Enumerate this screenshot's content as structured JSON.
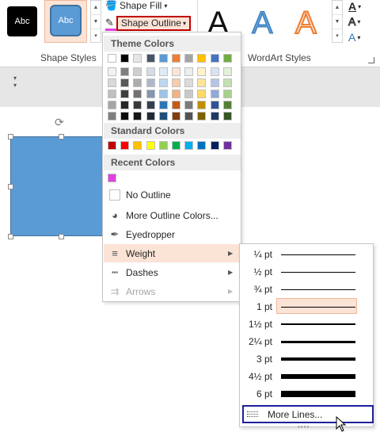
{
  "ribbon": {
    "style_sample_1": "Abc",
    "style_sample_2": "Abc",
    "shape_fill_label": "Shape Fill",
    "shape_outline_label": "Shape Outline",
    "shape_styles_label": "Shape Styles",
    "wordart_styles_label": "WordArt Styles",
    "wordart_sample": "A",
    "text_fill_letter": "A",
    "text_outline_letter": "A",
    "text_effects_letter": "A"
  },
  "menu": {
    "theme_colors_title": "Theme Colors",
    "standard_colors_title": "Standard Colors",
    "recent_colors_title": "Recent Colors",
    "theme_top_row": [
      "#ffffff",
      "#000000",
      "#e7e6e6",
      "#44546a",
      "#5b9bd5",
      "#ed7d31",
      "#a5a5a5",
      "#ffc000",
      "#4472c4",
      "#70ad47"
    ],
    "theme_shades": [
      [
        "#f2f2f2",
        "#7f7f7f",
        "#d0cece",
        "#d6dce4",
        "#deebf6",
        "#fbe4d5",
        "#ededed",
        "#fff2cc",
        "#dae3f3",
        "#e2efd9"
      ],
      [
        "#d8d8d8",
        "#595959",
        "#aeabab",
        "#adb9ca",
        "#bdd7ee",
        "#f7cbac",
        "#dbdbdb",
        "#ffe599",
        "#b4c6e7",
        "#c5e0b3"
      ],
      [
        "#bfbfbf",
        "#3f3f3f",
        "#757070",
        "#8496b0",
        "#9dc3e6",
        "#f4b183",
        "#c9c9c9",
        "#ffd965",
        "#8eaadb",
        "#a8d08d"
      ],
      [
        "#a5a5a5",
        "#262626",
        "#3a3838",
        "#323f4f",
        "#2e75b5",
        "#c55a11",
        "#7b7b7b",
        "#bf8f00",
        "#2f5496",
        "#538135"
      ],
      [
        "#7f7f7f",
        "#0c0c0c",
        "#171616",
        "#222a35",
        "#1e4e79",
        "#833c0b",
        "#525252",
        "#7f6000",
        "#1f3864",
        "#375623"
      ]
    ],
    "standard_colors": [
      "#c00000",
      "#ff0000",
      "#ffc000",
      "#ffff00",
      "#92d050",
      "#00b050",
      "#00b0f0",
      "#0070c0",
      "#002060",
      "#7030a0"
    ],
    "recent_colors": [
      "#e040e0"
    ],
    "no_outline": "No Outline",
    "more_outline_colors": "More Outline Colors...",
    "eyedropper": "Eyedropper",
    "weight": "Weight",
    "dashes": "Dashes",
    "arrows": "Arrows"
  },
  "weights": [
    {
      "label": "¼ pt",
      "value": 0.25,
      "selected": false
    },
    {
      "label": "½ pt",
      "value": 0.5,
      "selected": false
    },
    {
      "label": "¾ pt",
      "value": 0.75,
      "selected": false
    },
    {
      "label": "1 pt",
      "value": 1,
      "selected": true
    },
    {
      "label": "1½ pt",
      "value": 1.5,
      "selected": false
    },
    {
      "label": "2¼ pt",
      "value": 2.25,
      "selected": false
    },
    {
      "label": "3 pt",
      "value": 3,
      "selected": false
    },
    {
      "label": "4½ pt",
      "value": 4.5,
      "selected": false
    },
    {
      "label": "6 pt",
      "value": 6,
      "selected": false
    }
  ],
  "more_lines": "More Lines...",
  "colors": {
    "accent_outline": "#c00000",
    "highlight": "#fbe3d6",
    "shape_fill": "#5b9bd5",
    "focus_border": "#1f1f9c"
  }
}
